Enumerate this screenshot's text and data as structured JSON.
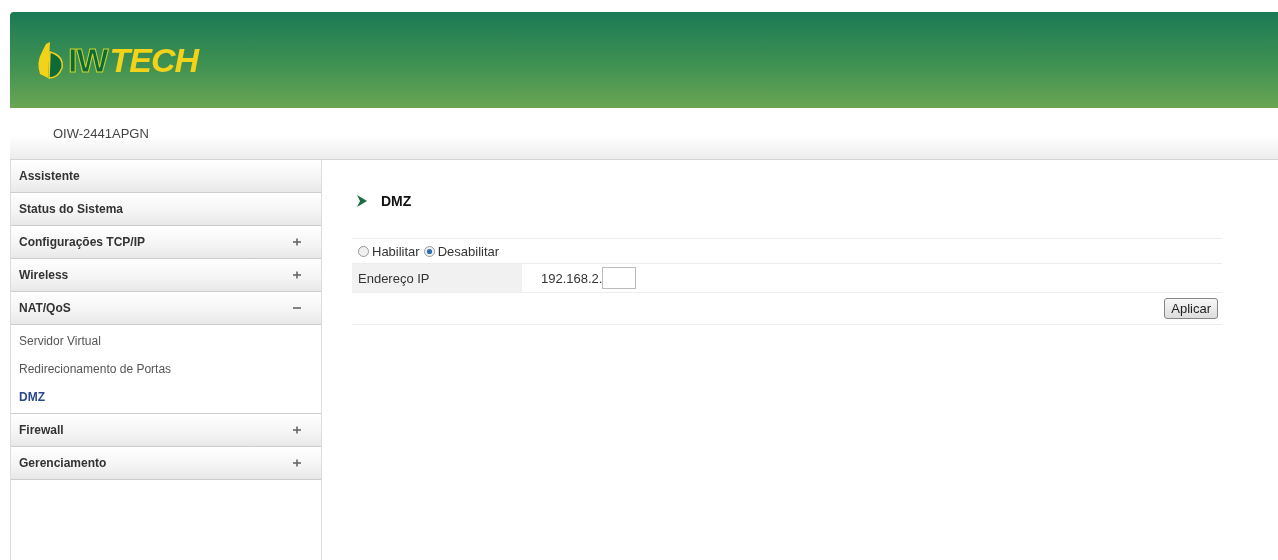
{
  "header": {
    "logo": {
      "mark": "IW",
      "accent": "TECH"
    }
  },
  "device": {
    "model": "OIW-2441APGN"
  },
  "sidebar": {
    "items": [
      {
        "label": "Assistente",
        "kind": "link"
      },
      {
        "label": "Status do Sistema",
        "kind": "link"
      },
      {
        "label": "Configurações TCP/IP",
        "kind": "group",
        "expanded": false
      },
      {
        "label": "Wireless",
        "kind": "group",
        "expanded": false
      },
      {
        "label": "NAT/QoS",
        "kind": "group",
        "expanded": true,
        "children": [
          {
            "label": "Servidor Virtual",
            "selected": false
          },
          {
            "label": "Redirecionamento de Portas",
            "selected": false
          },
          {
            "label": "DMZ",
            "selected": true
          }
        ]
      },
      {
        "label": "Firewall",
        "kind": "group",
        "expanded": false
      },
      {
        "label": "Gerenciamento",
        "kind": "group",
        "expanded": false
      }
    ]
  },
  "content": {
    "title": "DMZ",
    "mode_options": [
      {
        "label": "Habilitar",
        "selected": false
      },
      {
        "label": "Desabilitar",
        "selected": true
      }
    ],
    "ip_field": {
      "label": "Endereço IP",
      "prefix": "192.168.2."
    },
    "apply_button": "Aplicar"
  }
}
